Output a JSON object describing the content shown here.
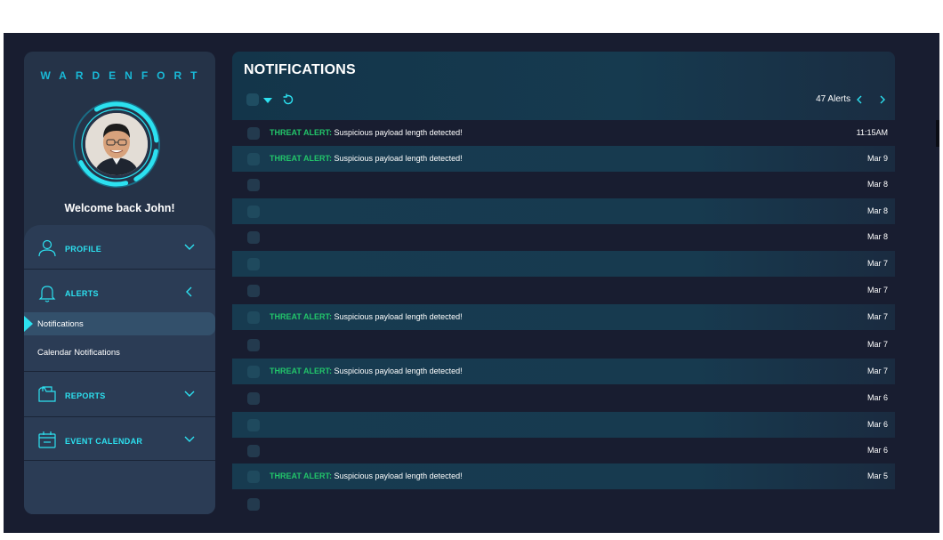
{
  "sidebar": {
    "brand": "WARDENFORT",
    "welcome": "Welcome back John!",
    "menu": [
      {
        "label": "PROFILE"
      },
      {
        "label": "ALERTS"
      },
      {
        "label": "REPORTS"
      },
      {
        "label": "EVENT CALENDAR"
      }
    ],
    "submenu": [
      {
        "label": "Notifications"
      },
      {
        "label": "Calendar Notifications"
      }
    ]
  },
  "header": {
    "title": "NOTIFICATIONS",
    "alerts_count": "47 Alerts"
  },
  "rows": [
    {
      "tag": "THREAT ALERT:",
      "message": "Suspicious payload length detected!",
      "date": "11:15AM"
    },
    {
      "tag": "THREAT ALERT:",
      "message": "Suspicious payload length detected!",
      "date": "Mar 9"
    },
    {
      "tag": "",
      "message": "",
      "date": "Mar 8"
    },
    {
      "tag": "",
      "message": "",
      "date": "Mar 8"
    },
    {
      "tag": "",
      "message": "",
      "date": "Mar 8"
    },
    {
      "tag": "",
      "message": "",
      "date": "Mar 7"
    },
    {
      "tag": "",
      "message": "",
      "date": "Mar 7"
    },
    {
      "tag": "THREAT ALERT:",
      "message": "Suspicious payload length detected!",
      "date": "Mar 7"
    },
    {
      "tag": "",
      "message": "",
      "date": "Mar 7"
    },
    {
      "tag": "THREAT ALERT:",
      "message": "Suspicious payload length detected!",
      "date": "Mar 7"
    },
    {
      "tag": "",
      "message": "",
      "date": "Mar 6"
    },
    {
      "tag": "",
      "message": "",
      "date": "Mar 6"
    },
    {
      "tag": "",
      "message": "",
      "date": "Mar 6"
    },
    {
      "tag": "THREAT ALERT:",
      "message": "Suspicious payload length detected!",
      "date": "Mar 5"
    },
    {
      "tag": "",
      "message": "",
      "date": ""
    }
  ],
  "colors": {
    "accent": "#2ce1f0",
    "alert_tag": "#22c56a",
    "background": "#181d30",
    "sidebar": "#253348"
  },
  "icons": [
    "user-icon",
    "bell-icon",
    "folder-icon",
    "calendar-icon",
    "chevron-down-icon",
    "chevron-left-icon",
    "chevron-right-icon",
    "refresh-icon",
    "caret-down-icon"
  ]
}
